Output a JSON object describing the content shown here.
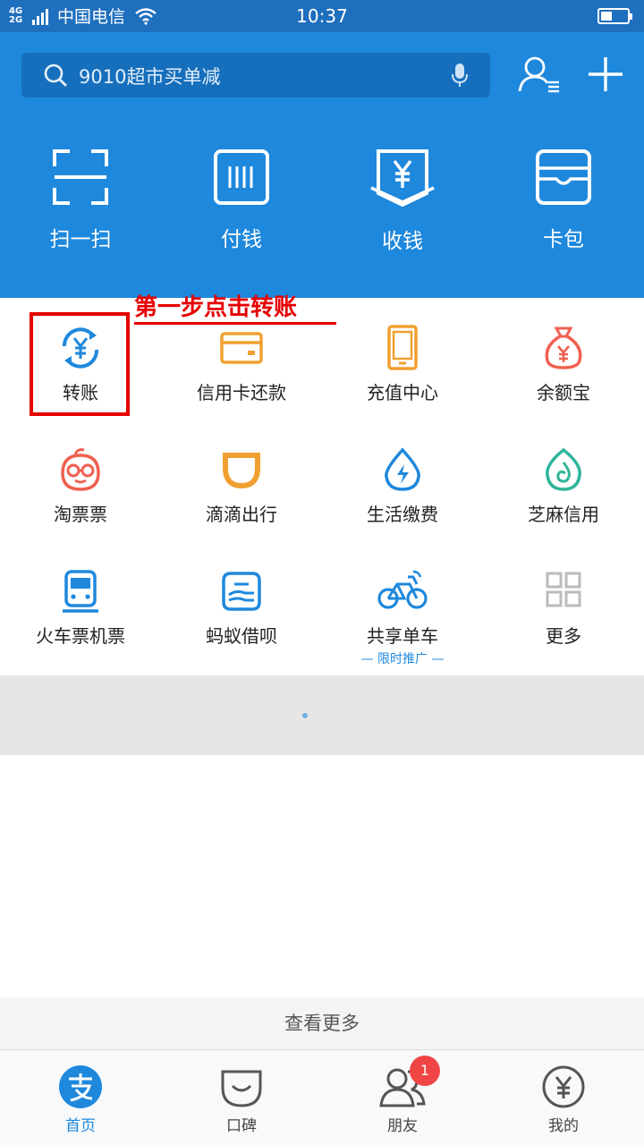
{
  "status_bar": {
    "network": "4G+\n2G",
    "carrier": "中国电信",
    "time": "10:37"
  },
  "header": {
    "search_placeholder": "9010超市买单减",
    "quick_actions": [
      {
        "label": "扫一扫",
        "icon": "scan-icon"
      },
      {
        "label": "付钱",
        "icon": "barcode-icon"
      },
      {
        "label": "收钱",
        "icon": "receive-money-icon"
      },
      {
        "label": "卡包",
        "icon": "wallet-icon"
      }
    ]
  },
  "services": [
    {
      "label": "转账",
      "icon": "transfer-icon",
      "color": "#1e88dd"
    },
    {
      "label": "信用卡还款",
      "icon": "credit-card-icon",
      "color": "#f0a030"
    },
    {
      "label": "充值中心",
      "icon": "phone-recharge-icon",
      "color": "#f0a030"
    },
    {
      "label": "余额宝",
      "icon": "money-bag-icon",
      "color": "#f06050"
    },
    {
      "label": "淘票票",
      "icon": "taopiaopiao-icon",
      "color": "#f06050"
    },
    {
      "label": "滴滴出行",
      "icon": "didi-icon",
      "color": "#f0a030"
    },
    {
      "label": "生活缴费",
      "icon": "utility-drop-icon",
      "color": "#1e88dd"
    },
    {
      "label": "芝麻信用",
      "icon": "sesame-credit-icon",
      "color": "#2fb59a"
    },
    {
      "label": "火车票机票",
      "icon": "train-icon",
      "color": "#1e88dd"
    },
    {
      "label": "蚂蚁借呗",
      "icon": "ant-loan-icon",
      "color": "#1e88dd"
    },
    {
      "label": "共享单车",
      "sub": "— 限时推广 —",
      "icon": "bicycle-icon",
      "color": "#1e88dd"
    },
    {
      "label": "更多",
      "icon": "more-grid-icon",
      "color": "#bbbbbb"
    }
  ],
  "annotation": {
    "text": "第一步点击转账"
  },
  "view_more": "查看更多",
  "tabs": [
    {
      "label": "首页",
      "icon": "alipay-home-icon",
      "active": true
    },
    {
      "label": "口碑",
      "icon": "koubei-icon",
      "active": false
    },
    {
      "label": "朋友",
      "icon": "friends-icon",
      "active": false,
      "badge": "1"
    },
    {
      "label": "我的",
      "icon": "my-account-icon",
      "active": false
    }
  ],
  "colors": {
    "brand_blue": "#1e88dd",
    "status_bar": "#1f6fbf",
    "annotation_red": "#e60000",
    "badge_red": "#f04545"
  }
}
